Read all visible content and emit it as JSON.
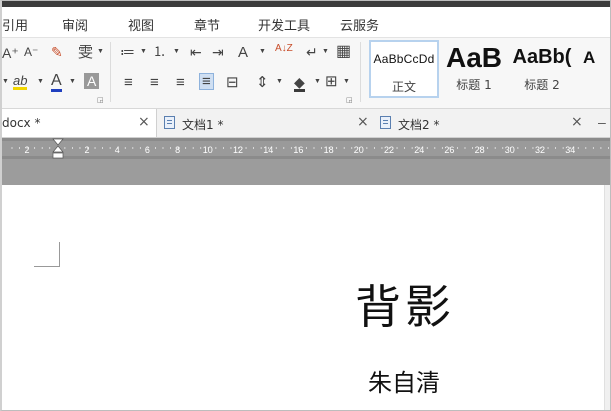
{
  "menu": {
    "items": [
      "引用",
      "审阅",
      "视图",
      "章节",
      "开发工具",
      "云服务"
    ]
  },
  "ribbon": {
    "font_grow": "A⁺",
    "font_shrink": "A⁻",
    "clear_format": "✎",
    "phonetic": "雯",
    "bullets": "≔",
    "numbering": "⒈",
    "outdent": "⇤",
    "indent": "⇥",
    "char_scale": "A",
    "sort": "A↓Z",
    "newline_marks": "↵",
    "table": "▦",
    "highlight": "ab",
    "font_color": "A",
    "char_shading": "A",
    "align_left": "≡",
    "align_center": "≡",
    "align_right": "≡",
    "justify": "≡",
    "distribute": "⊟",
    "line_spacing": "⇕",
    "shading": "◆",
    "borders": "⊞",
    "dialog_corner": "◲",
    "styles": [
      {
        "sample": "AaBbCcDd",
        "name": "正文"
      },
      {
        "sample": "AaB",
        "name": "标题 1"
      },
      {
        "sample": "AaBb(",
        "name": "标题 2"
      },
      {
        "sample": "A",
        "name": ""
      }
    ]
  },
  "tabs": [
    {
      "label": "docx *",
      "close": "×"
    },
    {
      "label": "文档1 *",
      "close": "×"
    },
    {
      "label": "文档2 *",
      "close": "×"
    }
  ],
  "ruler": {
    "ticks": [
      "2",
      "2",
      "4",
      "6",
      "8",
      "10",
      "12",
      "14",
      "16",
      "18",
      "20",
      "22",
      "24",
      "26",
      "28",
      "30",
      "32",
      "34"
    ]
  },
  "document": {
    "title": "背影",
    "author": "朱自清"
  },
  "colors": {
    "accent": "#b7d2ee",
    "highlight": "#f2d600",
    "font_color": "#d62020"
  }
}
